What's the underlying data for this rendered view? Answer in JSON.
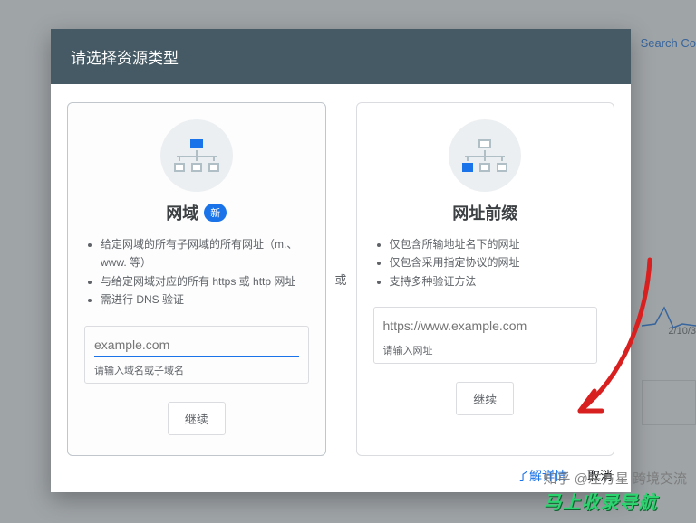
{
  "background": {
    "search_label": "Search Co",
    "date_label": "2/10/3"
  },
  "dialog": {
    "title": "请选择资源类型",
    "or_label": "或",
    "domain_card": {
      "title": "网域",
      "badge": "新",
      "bullets": [
        "给定网域的所有子网域的所有网址（m.、www. 等）",
        "与给定网域对应的所有 https 或 http 网址",
        "需进行 DNS 验证"
      ],
      "input_placeholder": "example.com",
      "input_hint": "请输入域名或子域名",
      "continue_label": "继续"
    },
    "prefix_card": {
      "title": "网址前缀",
      "bullets": [
        "仅包含所输地址名下的网址",
        "仅包含采用指定协议的网址",
        "支持多种验证方法"
      ],
      "input_placeholder": "https://www.example.com",
      "input_hint": "请输入网址",
      "continue_label": "继续"
    },
    "footer": {
      "learn_more": "了解详情",
      "cancel": "取消"
    }
  },
  "watermark": {
    "line1": "知乎 @左方星 跨境交流",
    "line2": "马上收录导航"
  }
}
